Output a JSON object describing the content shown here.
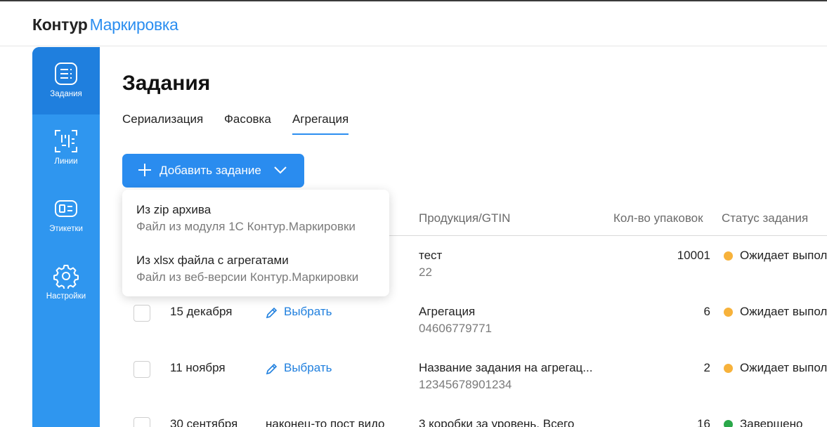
{
  "header": {
    "brand": "Контур",
    "product": "Маркировка"
  },
  "sidebar": {
    "items": [
      {
        "label": "Задания",
        "icon": "tasks-icon"
      },
      {
        "label": "Линии",
        "icon": "lines-icon"
      },
      {
        "label": "Этикетки",
        "icon": "label-icon"
      },
      {
        "label": "Настройки",
        "icon": "gear-icon"
      }
    ]
  },
  "page": {
    "title": "Задания"
  },
  "tabs": [
    {
      "label": "Сериализация"
    },
    {
      "label": "Фасовка"
    },
    {
      "label": "Агрегация"
    }
  ],
  "toolbar": {
    "add_label": "Добавить задание"
  },
  "dropdown": {
    "items": [
      {
        "title": "Из zip архива",
        "desc": "Файл из модуля 1С Контур.Маркировки"
      },
      {
        "title": "Из xlsx файла с агрегатами",
        "desc": "Файл из веб-версии Контур.Маркировки"
      }
    ]
  },
  "table": {
    "columns": {
      "product": "Продукция/GTIN",
      "count": "Кол-во упаковок",
      "status": "Статус задания"
    },
    "rows": [
      {
        "date": "",
        "name": "",
        "product": "тест",
        "gtin": "22",
        "count": "10001",
        "status": "Ожидает выпол",
        "status_kind": "waiting"
      },
      {
        "date": "15 декабря",
        "name": "Выбрать",
        "product": "Агрегация",
        "gtin": "04606779771",
        "count": "6",
        "status": "Ожидает выпол",
        "status_kind": "waiting"
      },
      {
        "date": "11 ноября",
        "name": "Выбрать",
        "product": "Название задания на агрегац...",
        "gtin": "12345678901234",
        "count": "2",
        "status": "Ожидает выпол",
        "status_kind": "waiting"
      },
      {
        "date": "30 сентября",
        "name": "наконец-то пост видо",
        "product": "3 коробки за уровень. Всего",
        "gtin": "",
        "count": "16",
        "status": "Завершено",
        "status_kind": "done"
      }
    ]
  },
  "colors": {
    "accent": "#2b8ef0",
    "sidebar": "#2f96ef",
    "waiting": "#f7b23b",
    "done": "#2aa84a"
  }
}
